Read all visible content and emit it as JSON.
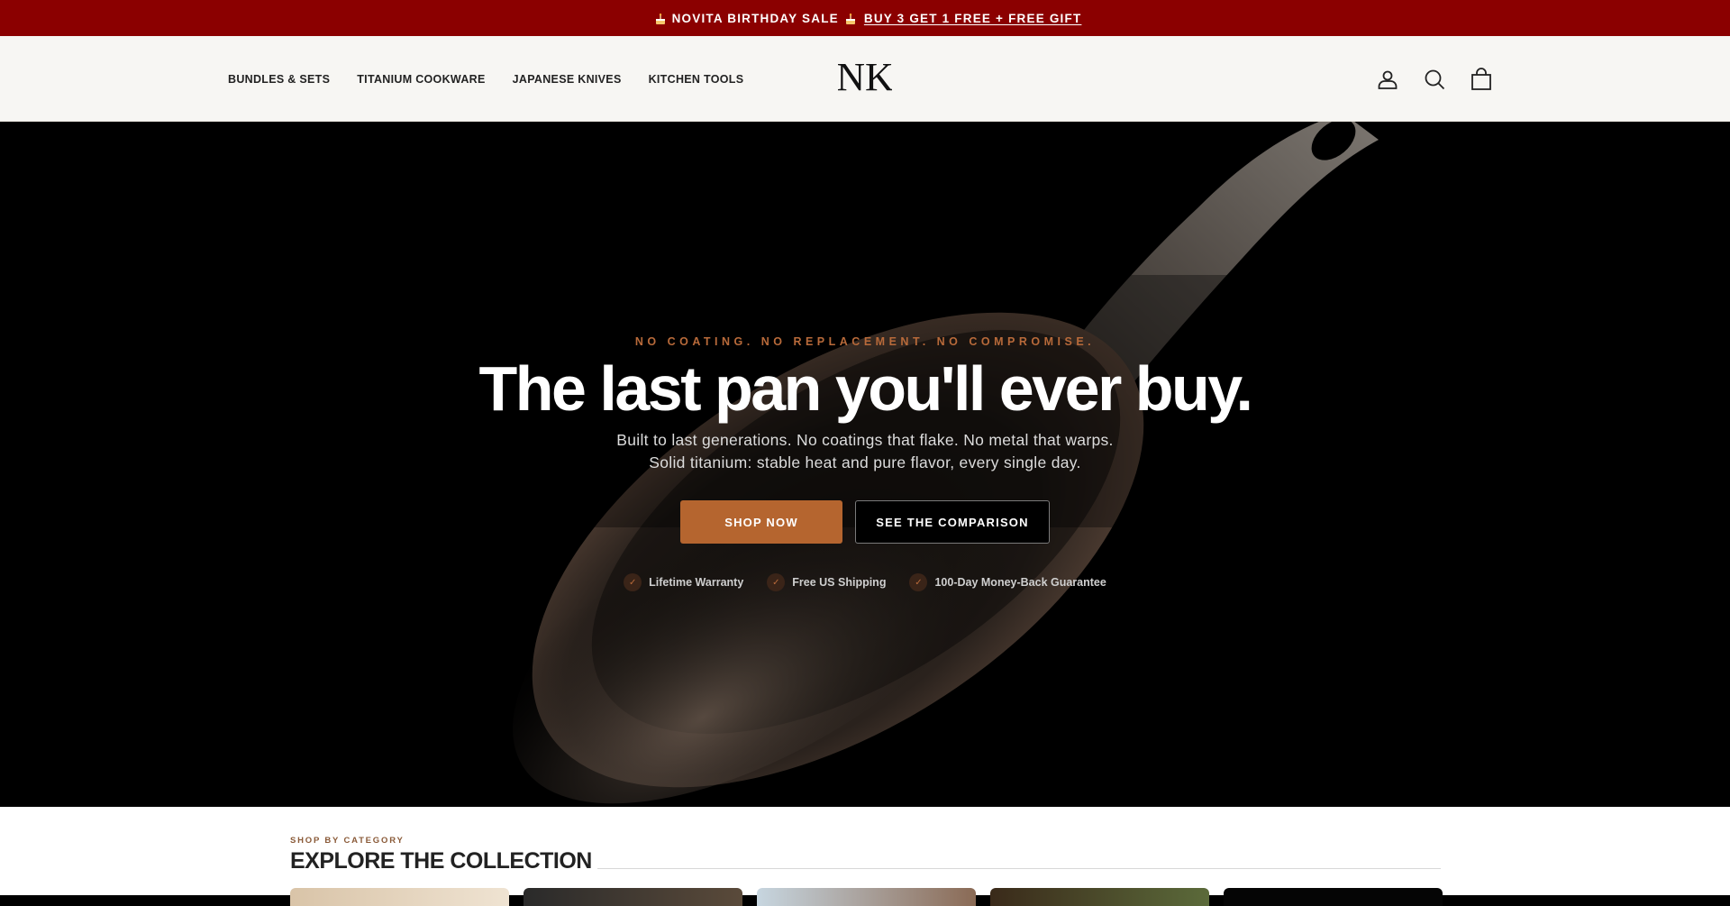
{
  "announcement": {
    "prefix": "NOVITA BIRTHDAY SALE",
    "link": "BUY 3 GET 1 FREE + FREE GIFT",
    "icon": "cake-icon"
  },
  "header": {
    "nav": [
      "BUNDLES & SETS",
      "TITANIUM COOKWARE",
      "JAPANESE KNIVES",
      "KITCHEN TOOLS"
    ],
    "logo_text": "NK",
    "icons": [
      "account-icon",
      "search-icon",
      "cart-icon"
    ]
  },
  "hero": {
    "eyebrow": "NO COATING. NO REPLACEMENT. NO COMPROMISE.",
    "headline": "The last pan you'll ever buy.",
    "sub_line1": "Built to last generations. No coatings that flake. No metal that warps.",
    "sub_line2": "Solid titanium: stable heat and pure flavor, every single day.",
    "primary_cta": "SHOP NOW",
    "secondary_cta": "SEE THE COMPARISON",
    "perks": [
      "Lifetime Warranty",
      "Free US Shipping",
      "100-Day Money-Back Guarantee"
    ]
  },
  "collection": {
    "eyebrow": "SHOP BY CATEGORY",
    "title": "EXPLORE THE COLLECTION"
  },
  "colors": {
    "announcement_bg": "#8b0000",
    "accent": "#b5652f",
    "header_bg": "#f7f6f3"
  }
}
